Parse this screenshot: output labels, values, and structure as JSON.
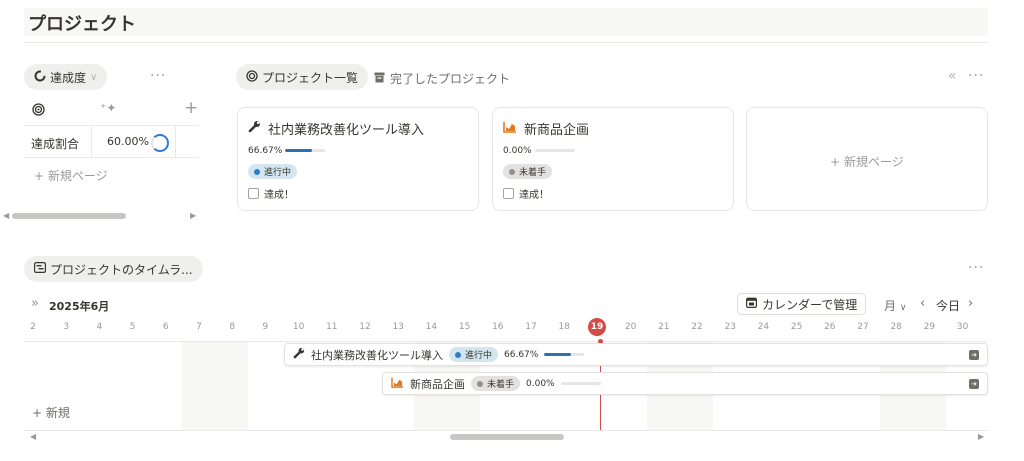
{
  "page": {
    "title": "プロジェクト"
  },
  "left_view": {
    "tab_label": "達成度",
    "more": "···",
    "add": "+",
    "row": {
      "label": "達成割合",
      "value": "60.00%"
    },
    "new_page": "+ 新規ページ"
  },
  "projects_view": {
    "tab_active": "プロジェクト一覧",
    "tab_other": "完了したプロジェクト",
    "collapse": "«",
    "more": "···",
    "cards": [
      {
        "icon": "wrench-icon",
        "title": "社内業務改善化ツール導入",
        "progress_label": "66.67%",
        "progress": 0.6667,
        "status": "進行中",
        "status_color": "#2e7ccf",
        "checkbox": "達成！"
      },
      {
        "icon": "chart-icon",
        "title": "新商品企画",
        "progress_label": "0.00%",
        "progress": 0.0,
        "status": "未着手",
        "status_color": "#91918e",
        "checkbox": "達成！"
      }
    ],
    "new_page": "+ 新規ページ"
  },
  "timeline": {
    "tab_label": "プロジェクトのタイムラ...",
    "more": "···",
    "expand": "»",
    "month": "2025年6月",
    "calendar_button": "カレンダーで管理",
    "scale": "月",
    "prev": "‹",
    "today": "今日",
    "next": "›",
    "days": [
      "2",
      "3",
      "4",
      "5",
      "6",
      "7",
      "8",
      "9",
      "10",
      "11",
      "12",
      "13",
      "14",
      "15",
      "16",
      "17",
      "18",
      "19",
      "20",
      "21",
      "22",
      "23",
      "24",
      "25",
      "26",
      "27",
      "28",
      "29",
      "30"
    ],
    "today_day": "19",
    "items": [
      {
        "title": "社内業務改善化ツール導入",
        "status": "進行中",
        "progress_label": "66.67%",
        "progress": 0.6667
      },
      {
        "title": "新商品企画",
        "status": "未着手",
        "progress_label": "0.00%",
        "progress": 0.0
      }
    ],
    "new_label": "+ 新規"
  },
  "colors": {
    "accent": "#2e7ccf",
    "today": "#d44c47",
    "chart_icon": "#e07b24"
  }
}
